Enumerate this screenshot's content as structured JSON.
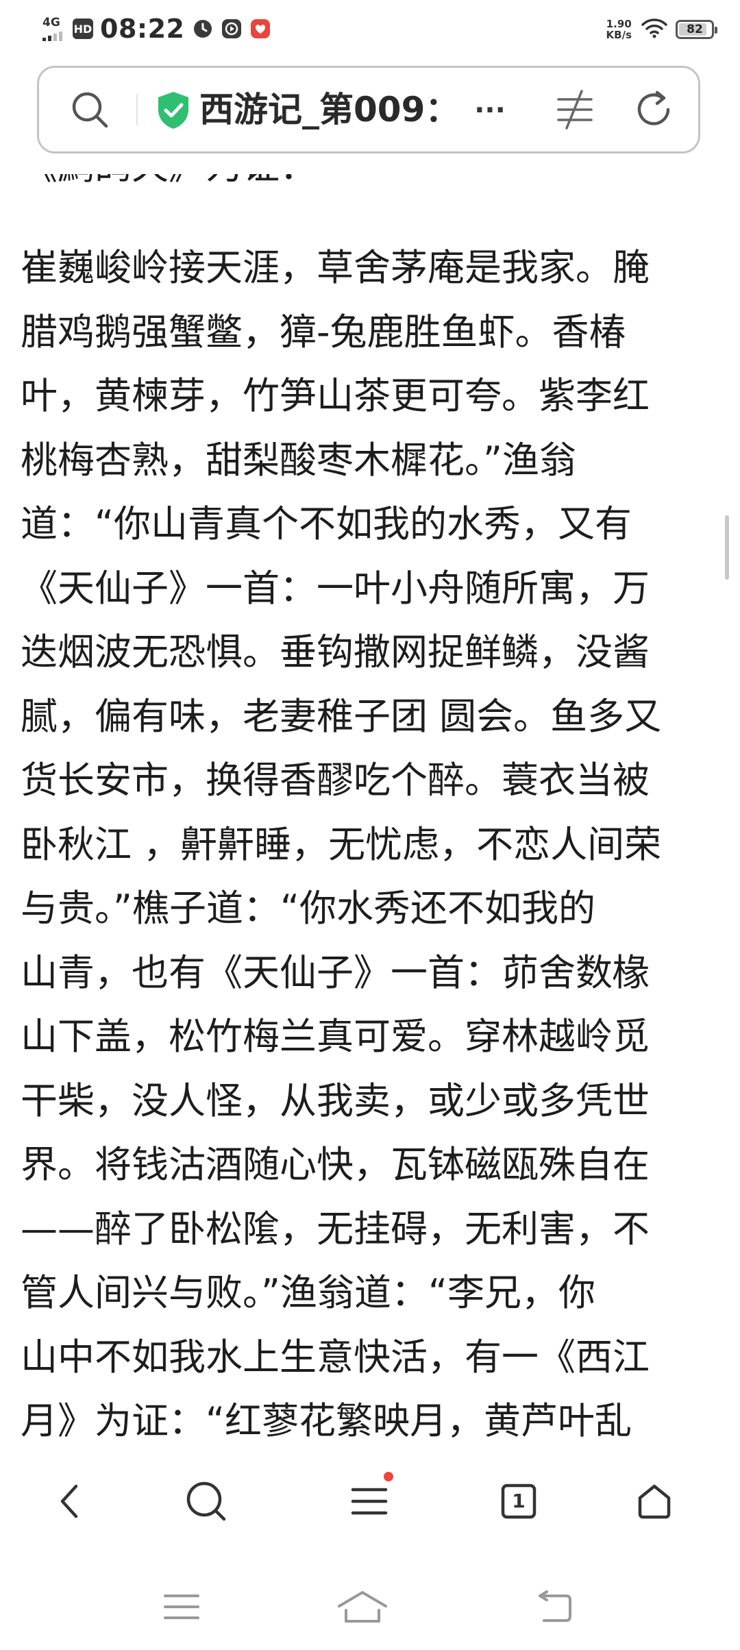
{
  "status_bar": {
    "network": "4G",
    "hd": "HD",
    "time": "08:22",
    "speed_value": "1.90",
    "speed_unit": "KB/s",
    "battery": "82"
  },
  "address_bar": {
    "title": "西游记_第009：",
    "more": "···"
  },
  "content": {
    "partial_line": "《鹧鸪天》为证：",
    "lines": [
      "崔巍峻岭接天涯，草舍茅庵是我家。腌",
      "腊鸡鹅强蟹鳖，獐-兔鹿胜鱼虾。香椿",
      "叶，黄楝芽，竹笋山茶更可夸。紫李红",
      "桃梅杏熟，甜梨酸枣木樨花。”渔翁",
      "道：“你山青真个不如我的水秀，又有",
      "《天仙子》一首：一叶小舟随所寓，万",
      "迭烟波无恐惧。垂钩撒网捉鲜鳞，没酱",
      "腻，偏有味，老妻稚子团 圆会。鱼多又",
      "货长安市，换得香醪吃个醉。蓑衣当被",
      "卧秋江 ，鼾鼾睡，无忧虑，不恋人间荣",
      "与贵。”樵子道：“你水秀还不如我的",
      "山青，也有《天仙子》一首：茆舍数椽",
      "山下盖，松竹梅兰真可爱。穿林越岭觅",
      "干柴，没人怪，从我卖，或少或多凭世",
      "界。将钱沽酒随心快，瓦钵磁瓯殊自在",
      "——醉了卧松隂，无挂碍，无利害，不",
      "管人间兴与败。”渔翁道：“李兄，你",
      "山中不如我水上生意快活，有一《西江",
      "月》为证：“红蓼花繁映月，黄芦叶乱"
    ]
  },
  "toolbar": {
    "tab_count": "1"
  },
  "icons": {
    "accent_green": "#2fbf71",
    "badge_red": "#f0443d"
  }
}
